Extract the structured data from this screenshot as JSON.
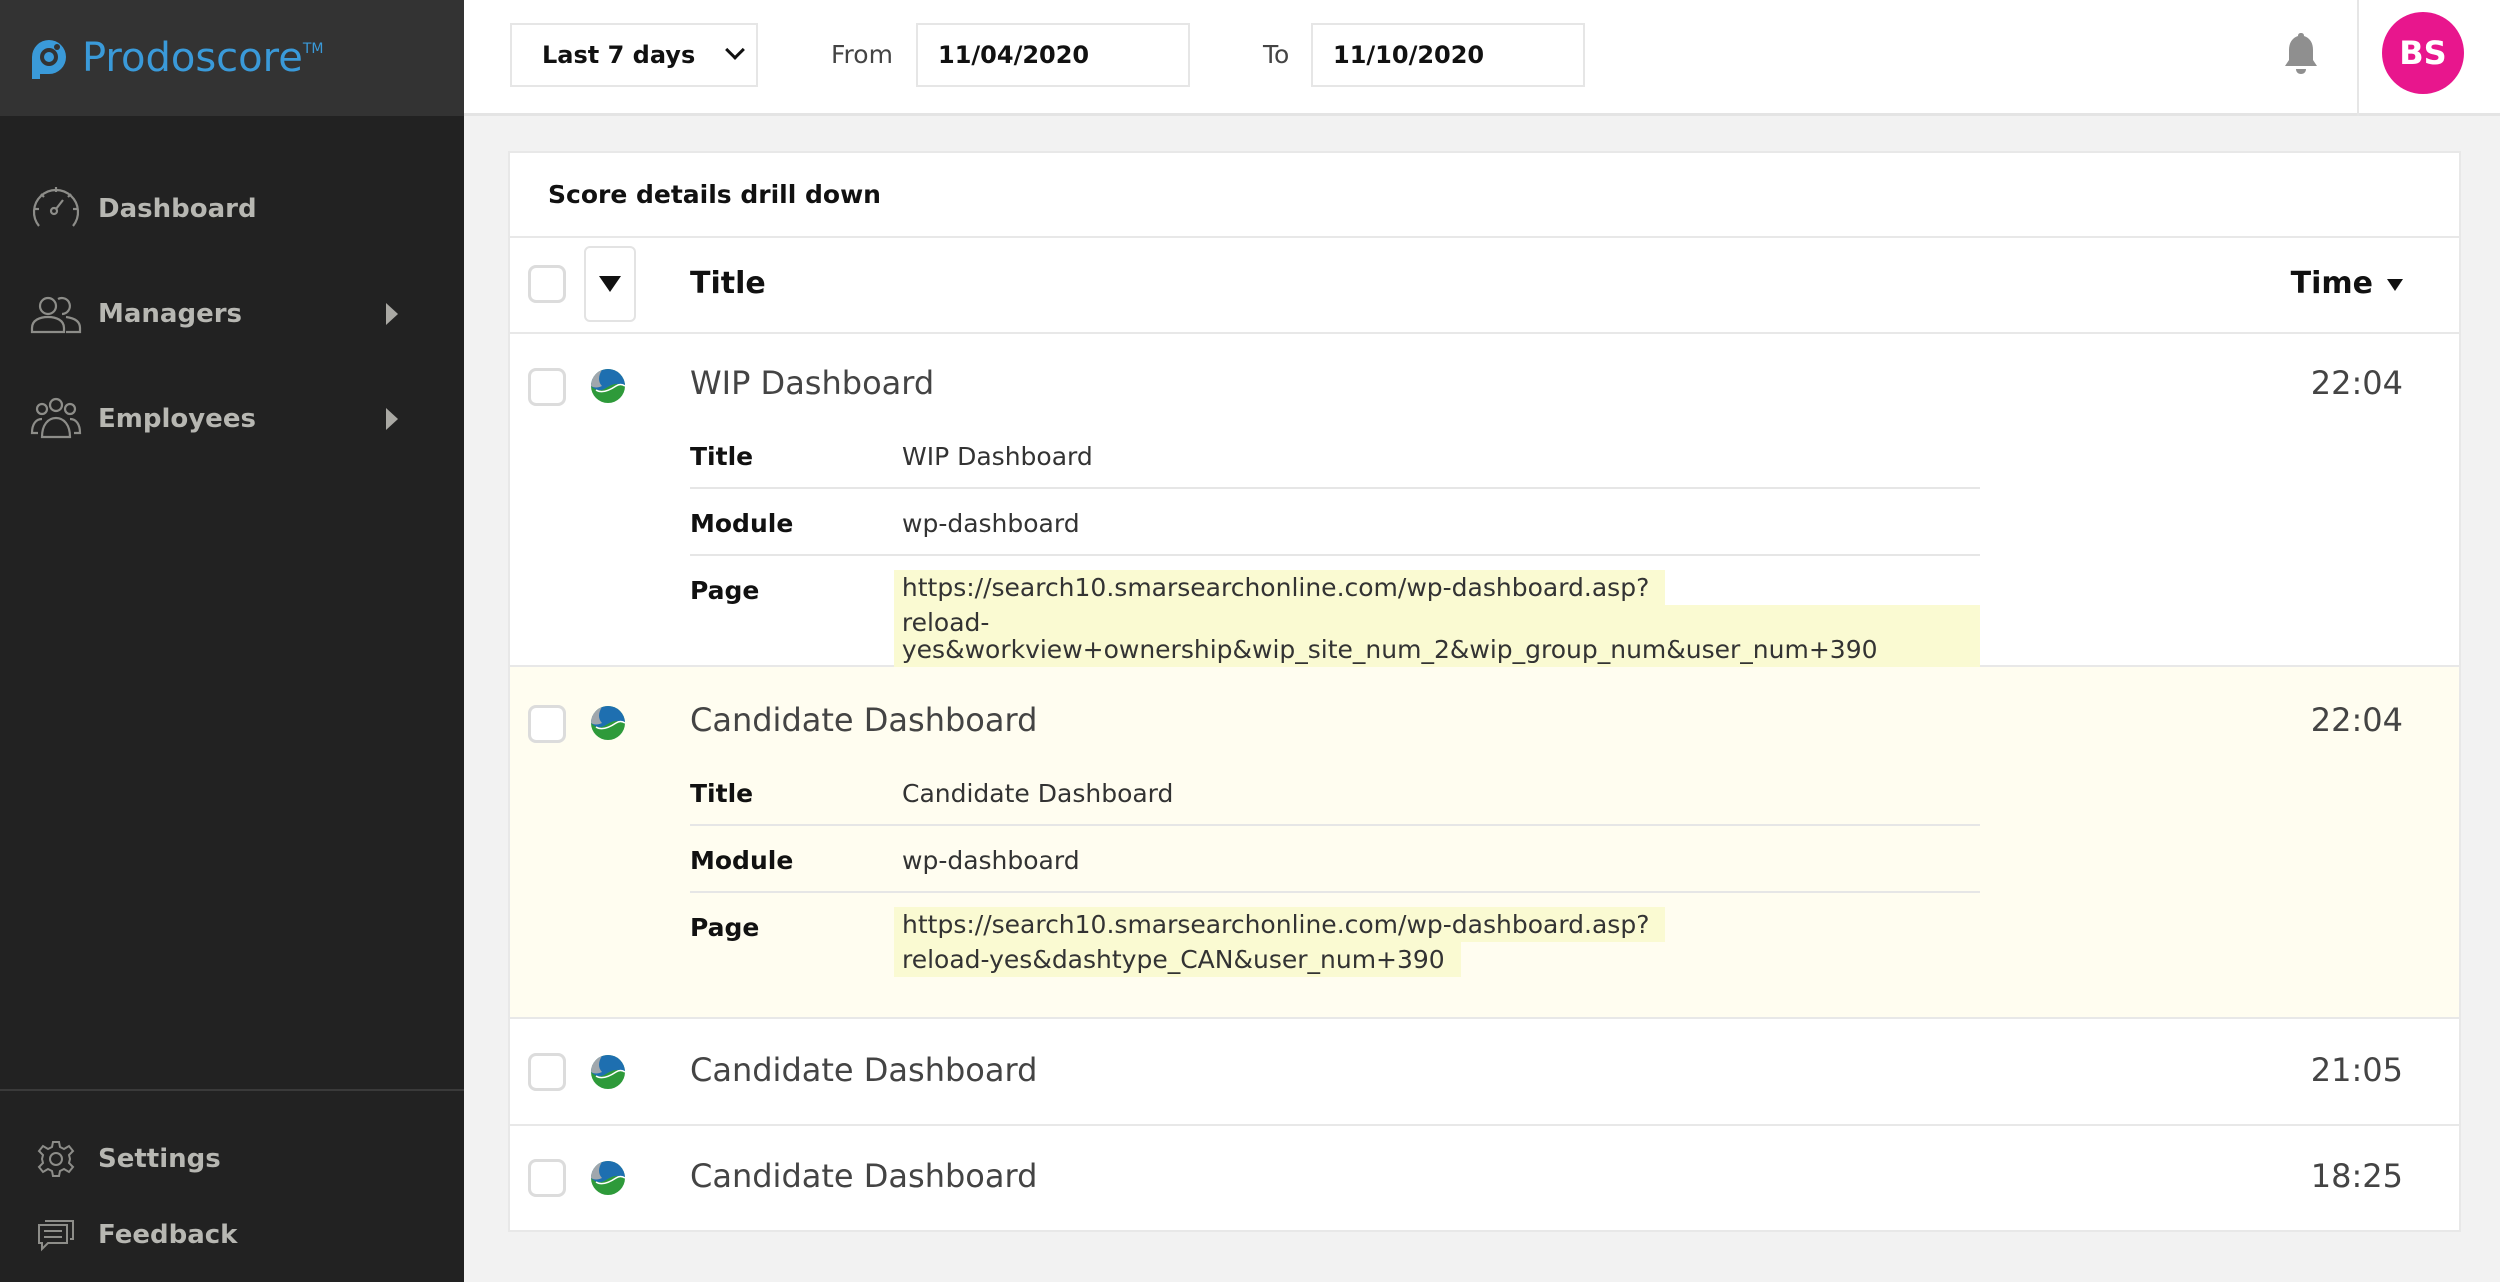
{
  "app": {
    "brand_name": "Prodoscore",
    "brand_tm": "TM",
    "brand_color": "#3a9ad9"
  },
  "sidebar": {
    "items": [
      {
        "label": "Dashboard",
        "icon": "speedometer-icon",
        "has_submenu": false
      },
      {
        "label": "Managers",
        "icon": "managers-icon",
        "has_submenu": true
      },
      {
        "label": "Employees",
        "icon": "employees-icon",
        "has_submenu": true
      }
    ],
    "bottom_items": [
      {
        "label": "Settings",
        "icon": "gear-icon"
      },
      {
        "label": "Feedback",
        "icon": "chat-bubbles-icon"
      }
    ]
  },
  "header": {
    "range_select": {
      "value": "Last 7 days"
    },
    "from_label": "From",
    "from_value": "11/04/2020",
    "to_label": "To",
    "to_value": "11/10/2020",
    "avatar_initials": "BS",
    "avatar_color": "#e8168d"
  },
  "panel": {
    "title": "Score details drill down",
    "columns": {
      "title": "Title",
      "time": "Time"
    },
    "detail_labels": {
      "title": "Title",
      "module": "Module",
      "page": "Page"
    },
    "rows": [
      {
        "title": "WIP Dashboard",
        "time": "22:04",
        "expanded": true,
        "highlighted": false,
        "details": {
          "title": "WIP Dashboard",
          "module": "wp-dashboard",
          "page_line1": "https://search10.smarsearchonline.com/wp-dashboard.asp?",
          "page_line2": "reload-yes&workview+ownership&wip_site_num_2&wip_group_num&user_num+390"
        }
      },
      {
        "title": "Candidate Dashboard",
        "time": "22:04",
        "expanded": true,
        "highlighted": true,
        "details": {
          "title": "Candidate Dashboard",
          "module": "wp-dashboard",
          "page_line1": "https://search10.smarsearchonline.com/wp-dashboard.asp?",
          "page_line2": "reload-yes&dashtype_CAN&user_num+390"
        }
      },
      {
        "title": "Candidate Dashboard",
        "time": "21:05",
        "expanded": false,
        "highlighted": false
      },
      {
        "title": "Candidate Dashboard",
        "time": "18:25",
        "expanded": false,
        "highlighted": false
      }
    ]
  }
}
